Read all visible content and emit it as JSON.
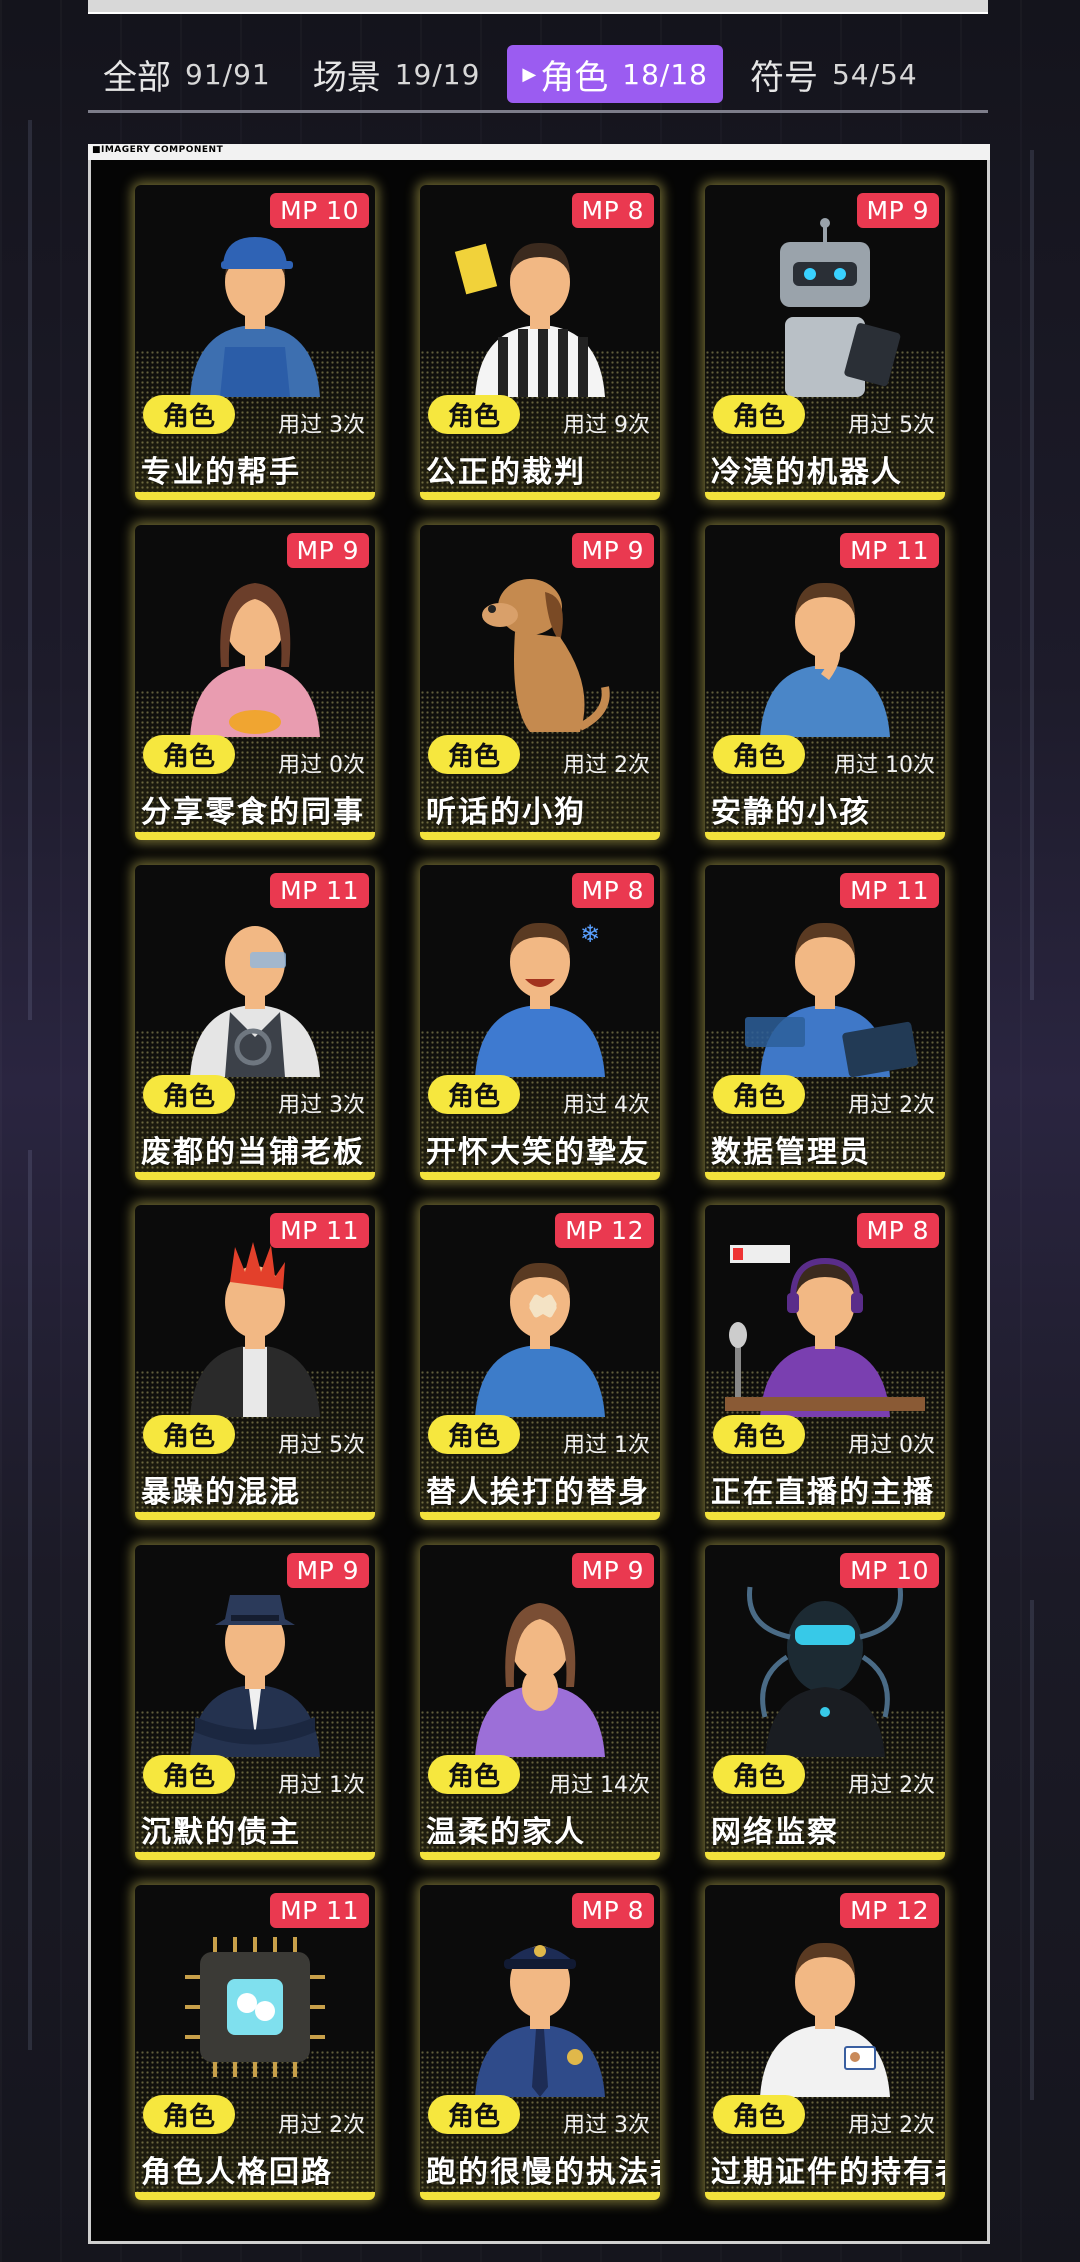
{
  "tabs": [
    {
      "label": "全部",
      "count": "91/91"
    },
    {
      "label": "场景",
      "count": "19/19"
    },
    {
      "label": "角色",
      "count": "18/18"
    },
    {
      "label": "符号",
      "count": "54/54"
    }
  ],
  "active_tab": "角色",
  "panel_title": "■IMAGERY COMPONENT",
  "cards": [
    {
      "mp": "MP 10",
      "tag": "角色",
      "used": "用过 3次",
      "name": "专业的帮手",
      "icon": "worker-icon"
    },
    {
      "mp": "MP 8",
      "tag": "角色",
      "used": "用过 9次",
      "name": "公正的裁判",
      "icon": "referee-icon"
    },
    {
      "mp": "MP 9",
      "tag": "角色",
      "used": "用过 5次",
      "name": "冷漠的机器人",
      "icon": "robot-icon"
    },
    {
      "mp": "MP 9",
      "tag": "角色",
      "used": "用过 0次",
      "name": "分享零食的同事",
      "icon": "coworker-snack-icon"
    },
    {
      "mp": "MP 9",
      "tag": "角色",
      "used": "用过 2次",
      "name": "听话的小狗",
      "icon": "dog-icon"
    },
    {
      "mp": "MP 11",
      "tag": "角色",
      "used": "用过 10次",
      "name": "安静的小孩",
      "icon": "child-icon"
    },
    {
      "mp": "MP 11",
      "tag": "角色",
      "used": "用过 3次",
      "name": "废都的当铺老板",
      "icon": "pawnshop-owner-icon"
    },
    {
      "mp": "MP 8",
      "tag": "角色",
      "used": "用过 4次",
      "name": "开怀大笑的挚友",
      "icon": "laughing-friend-icon"
    },
    {
      "mp": "MP 11",
      "tag": "角色",
      "used": "用过 2次",
      "name": "数据管理员",
      "icon": "data-admin-icon"
    },
    {
      "mp": "MP 11",
      "tag": "角色",
      "used": "用过 5次",
      "name": "暴躁的混混",
      "icon": "punk-icon"
    },
    {
      "mp": "MP 12",
      "tag": "角色",
      "used": "用过 1次",
      "name": "替人挨打的替身",
      "icon": "stand-in-icon"
    },
    {
      "mp": "MP 8",
      "tag": "角色",
      "used": "用过 0次",
      "name": "正在直播的主播",
      "icon": "streamer-icon"
    },
    {
      "mp": "MP 9",
      "tag": "角色",
      "used": "用过 1次",
      "name": "沉默的债主",
      "icon": "creditor-icon"
    },
    {
      "mp": "MP 9",
      "tag": "角色",
      "used": "用过 14次",
      "name": "温柔的家人",
      "icon": "family-icon"
    },
    {
      "mp": "MP 10",
      "tag": "角色",
      "used": "用过 2次",
      "name": "网络监察",
      "icon": "cyber-police-icon"
    },
    {
      "mp": "MP 11",
      "tag": "角色",
      "used": "用过 2次",
      "name": "角色人格回路",
      "icon": "persona-circuit-icon"
    },
    {
      "mp": "MP 8",
      "tag": "角色",
      "used": "用过 3次",
      "name": "跑的很慢的执法者",
      "icon": "police-icon"
    },
    {
      "mp": "MP 12",
      "tag": "角色",
      "used": "用过 2次",
      "name": "过期证件的持有者",
      "icon": "id-holder-icon"
    }
  ]
}
